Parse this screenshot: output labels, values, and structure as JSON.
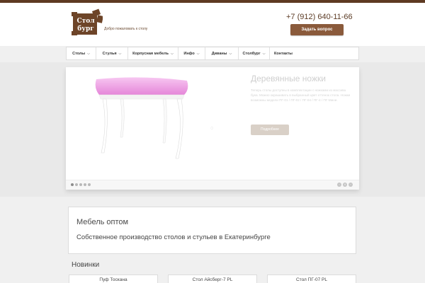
{
  "header": {
    "logo_text_1": "Стол",
    "logo_text_2": "бург",
    "tagline": "Добро пожаловать к столу",
    "phone": "+7 (912) 640-11-66",
    "ask_button": "Задать вопрос"
  },
  "nav": {
    "items": [
      {
        "label": "Столы",
        "has_dropdown": true
      },
      {
        "label": "Стулья",
        "has_dropdown": true
      },
      {
        "label": "Корпусная мебель",
        "has_dropdown": true
      },
      {
        "label": "Инфо",
        "has_dropdown": true
      },
      {
        "label": "Диваны",
        "has_dropdown": true
      },
      {
        "label": "Столбург",
        "has_dropdown": true
      },
      {
        "label": "Контакты",
        "has_dropdown": false
      }
    ]
  },
  "slider": {
    "title": "Деревянные ножки",
    "text": "Теперь столы доступны в комплектации с ножками из массива бука. Можно окрашивать в выбранный цвет оттенок стола. Ножки возможны модели ПГ-01 / ПГ-02 / ПГ-04 / ПГ-4 / ПГ-Мини.",
    "button": "Подробнее",
    "dots_count": 5,
    "active_dot": 0,
    "arrow_prev": "‹",
    "arrow_pause": "॥",
    "arrow_next": "›"
  },
  "content": {
    "title": "Мебель оптом",
    "subtitle": "Собственное производство столов и стульев в Екатеринбурге"
  },
  "new_items": {
    "title": "Новинки",
    "cards": [
      "Пуф Тоскана",
      "Стол Айсберг-7 PL",
      "Стол ПГ-07 PL"
    ]
  },
  "colors": {
    "brand": "#5e3a22",
    "button": "#8a5a3b",
    "slide_pink": "#f0a8e6"
  },
  "icons": {
    "chevron": "chevron-down-icon",
    "spinner": "loading-icon"
  }
}
